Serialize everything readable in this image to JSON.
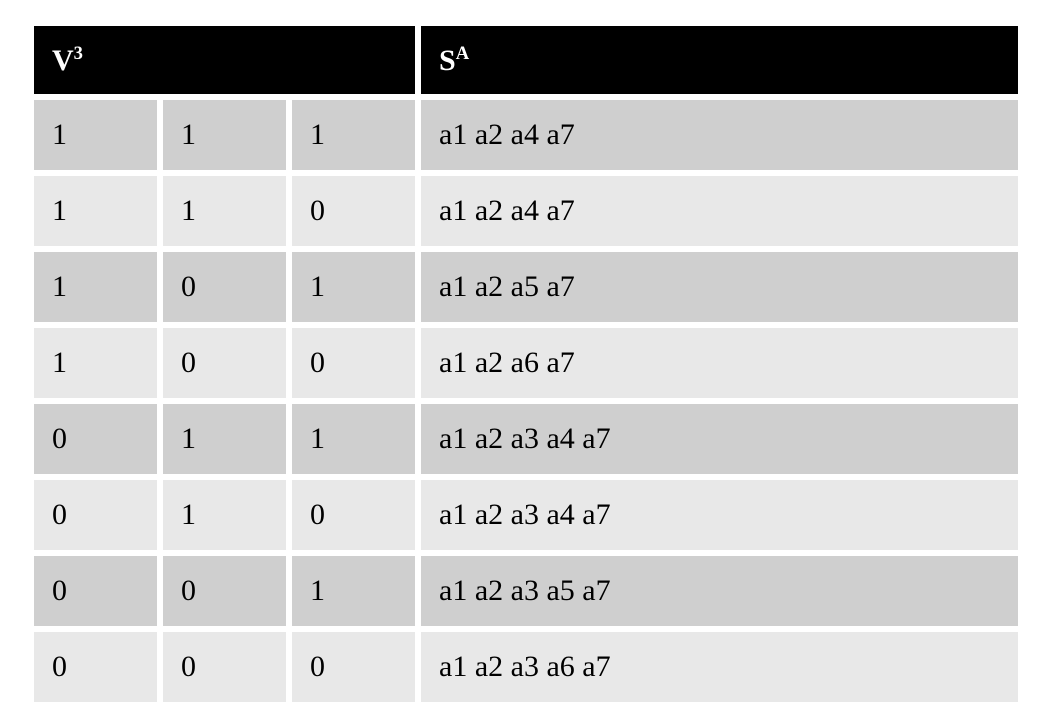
{
  "table": {
    "headers": {
      "V_base": "V",
      "V_sup": "3",
      "S_base": "S",
      "S_sup": "A"
    },
    "rows": [
      {
        "v1": "1",
        "v2": "1",
        "v3": "1",
        "sa": "a1 a2 a4 a7"
      },
      {
        "v1": "1",
        "v2": "1",
        "v3": "0",
        "sa": "a1 a2 a4 a7"
      },
      {
        "v1": "1",
        "v2": "0",
        "v3": "1",
        "sa": "a1 a2 a5 a7"
      },
      {
        "v1": "1",
        "v2": "0",
        "v3": "0",
        "sa": "a1 a2 a6 a7"
      },
      {
        "v1": "0",
        "v2": "1",
        "v3": "1",
        "sa": "a1 a2 a3 a4 a7"
      },
      {
        "v1": "0",
        "v2": "1",
        "v3": "0",
        "sa": "a1 a2 a3 a4 a7"
      },
      {
        "v1": "0",
        "v2": "0",
        "v3": "1",
        "sa": "a1 a2 a3 a5 a7"
      },
      {
        "v1": "0",
        "v2": "0",
        "v3": "0",
        "sa": "a1 a2 a3 a6 a7"
      }
    ]
  }
}
